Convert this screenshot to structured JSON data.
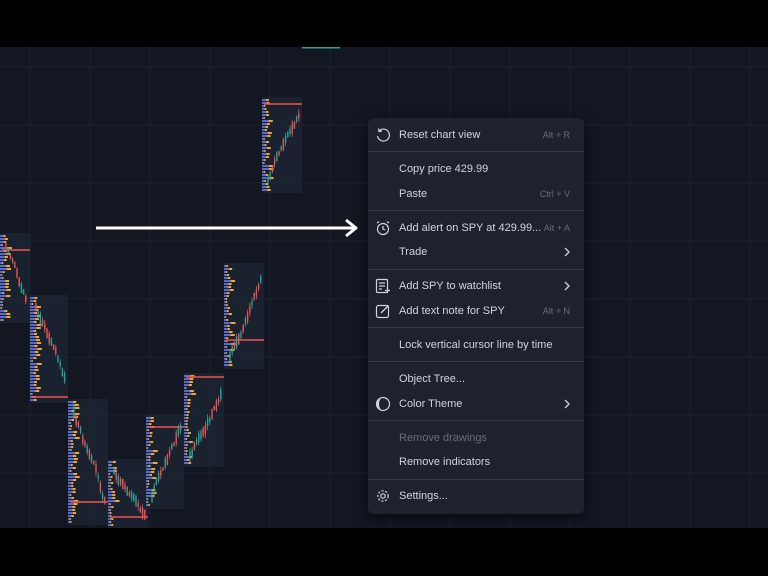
{
  "theme": {
    "background": "#131722",
    "menu_background": "#1e222d",
    "text": "#d1d4dc",
    "muted_text": "#6a6d78",
    "bullish": "#26a69a",
    "bearish": "#ef5350",
    "profile_blue": "#5b6ad0",
    "profile_orange": "#f0a830"
  },
  "context_menu": {
    "reset_chart_view": {
      "label": "Reset chart view",
      "shortcut": "Alt + R",
      "icon": "reset-icon"
    },
    "copy_price": {
      "label": "Copy price 429.99"
    },
    "paste": {
      "label": "Paste",
      "shortcut": "Ctrl + V"
    },
    "add_alert": {
      "label": "Add alert on SPY at 429.99...",
      "shortcut": "Alt + A",
      "icon": "alarm-clock-icon"
    },
    "trade": {
      "label": "Trade",
      "submenu": true
    },
    "add_to_watchlist": {
      "label": "Add SPY to watchlist",
      "submenu": true,
      "icon": "watchlist-add-icon"
    },
    "add_text_note": {
      "label": "Add text note for SPY",
      "shortcut": "Alt + N",
      "icon": "edit-note-icon"
    },
    "lock_cursor": {
      "label": "Lock vertical cursor line by time"
    },
    "object_tree": {
      "label": "Object Tree..."
    },
    "color_theme": {
      "label": "Color Theme",
      "submenu": true,
      "icon": "moon-icon"
    },
    "remove_drawings": {
      "label": "Remove drawings",
      "disabled": true
    },
    "remove_indicators": {
      "label": "Remove indicators"
    },
    "settings": {
      "label": "Settings...",
      "icon": "gear-icon"
    }
  }
}
